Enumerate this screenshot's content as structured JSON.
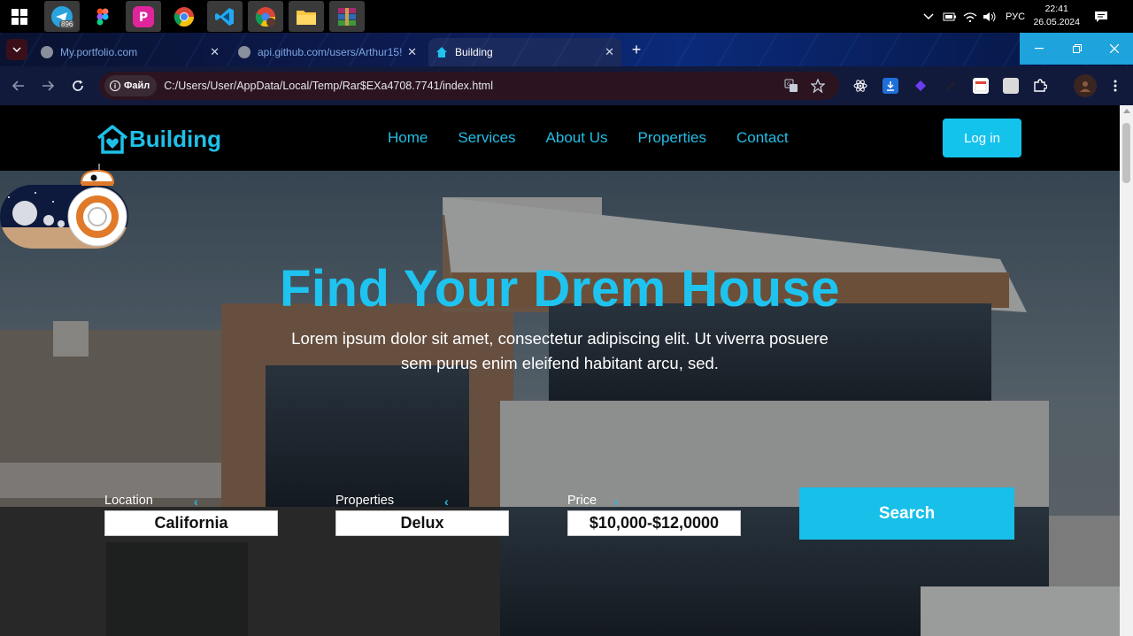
{
  "taskbar": {
    "apps": [
      {
        "name": "telegram",
        "badge": "896"
      },
      {
        "name": "figma",
        "badge": ""
      },
      {
        "name": "picsart",
        "badge": ""
      },
      {
        "name": "chrome",
        "badge": ""
      },
      {
        "name": "vscode",
        "badge": ""
      },
      {
        "name": "chrome-profile",
        "badge": ""
      },
      {
        "name": "file-explorer",
        "badge": ""
      },
      {
        "name": "winrar",
        "badge": ""
      }
    ],
    "language": "РУС",
    "time": "22:41",
    "date": "26.05.2024"
  },
  "browser": {
    "tabs": [
      {
        "title": "My.portfolio.com",
        "active": false
      },
      {
        "title": "api.github.com/users/Arthur15!",
        "active": false
      },
      {
        "title": "Building",
        "active": true
      }
    ],
    "site_info_label": "Файл",
    "url": "C:/Users/User/AppData/Local/Temp/Rar$EXa4708.7741/index.html"
  },
  "site": {
    "logo_text": "Building",
    "nav": [
      "Home",
      "Services",
      "About Us",
      "Properties",
      "Contact"
    ],
    "login_label": "Log in",
    "hero": {
      "title": "Find Your Drem House",
      "text": "Lorem ipsum dolor sit amet, consectetur adipiscing elit. Ut viverra posuere sem purus enim eleifend habitant arcu, sed."
    },
    "search": {
      "location_label": "Location",
      "location_value": "California",
      "properties_label": "Properties",
      "properties_value": "Delux",
      "price_label": "Price",
      "price_value": "$10,000-$12,0000",
      "button_label": "Search"
    }
  },
  "colors": {
    "accent": "#1ec4ef",
    "header_bg": "#000000"
  }
}
